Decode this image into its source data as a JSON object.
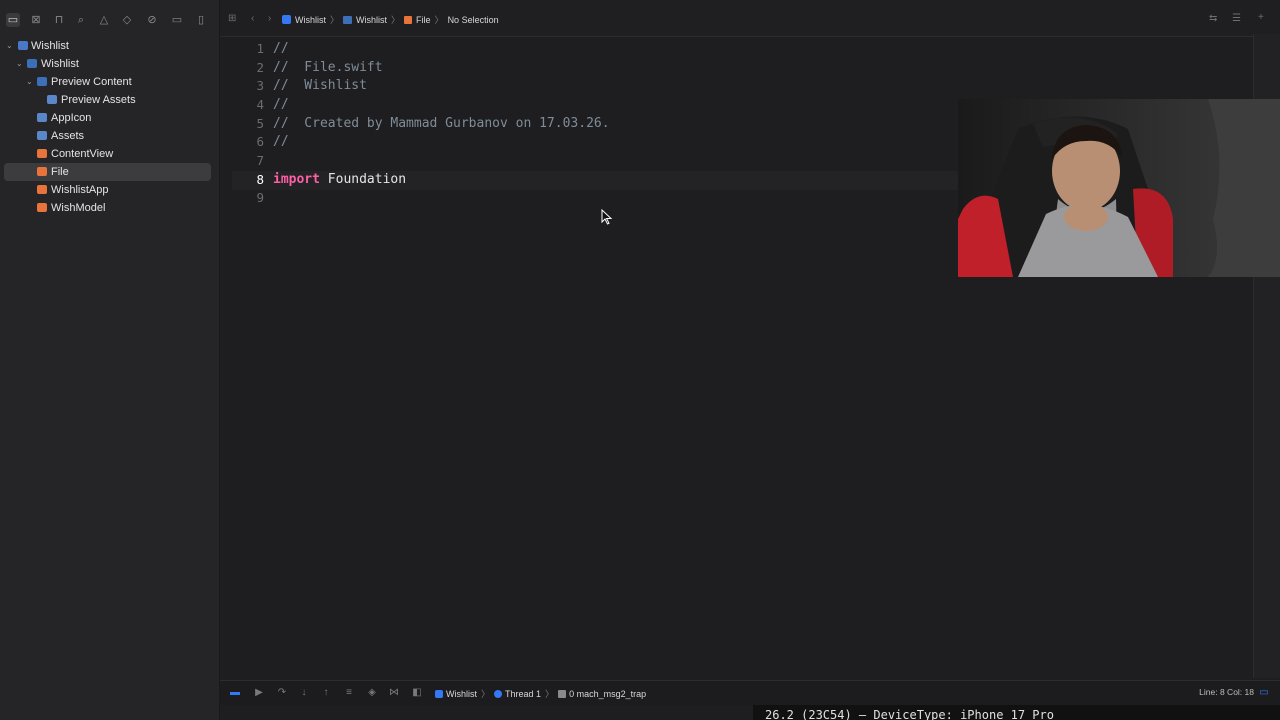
{
  "sidebar": {
    "toolbar_icons": [
      "folder-icon",
      "xmark-square-icon",
      "bookmark-icon",
      "search-icon",
      "warning-icon",
      "diamond-icon",
      "tag-icon",
      "label-icon",
      "document-icon"
    ],
    "tree": [
      {
        "label": "Wishlist",
        "kind": "project"
      },
      {
        "label": "Wishlist",
        "kind": "folder"
      },
      {
        "label": "Preview Content",
        "kind": "folder"
      },
      {
        "label": "Preview Assets",
        "kind": "assets"
      },
      {
        "label": "AppIcon",
        "kind": "file"
      },
      {
        "label": "Assets",
        "kind": "file"
      },
      {
        "label": "ContentView",
        "kind": "file"
      },
      {
        "label": "File",
        "kind": "file",
        "selected": true
      },
      {
        "label": "WishlistApp",
        "kind": "file"
      },
      {
        "label": "WishModel",
        "kind": "file"
      }
    ]
  },
  "breadcrumb": {
    "items": [
      "Wishlist",
      "Wishlist",
      "File",
      "No Selection"
    ]
  },
  "editor": {
    "line_numbers": [
      "1",
      "2",
      "3",
      "4",
      "5",
      "6",
      "7",
      "8",
      "9"
    ],
    "current_line": "8",
    "lines": [
      "//",
      "//  File.swift",
      "//  Wishlist",
      "//",
      "//  Created by Mammad Gurbanov on 17.03.26.",
      "//",
      "",
      "",
      ""
    ],
    "import_keyword": "import",
    "import_module": "Foundation"
  },
  "debug_bar": {
    "crumbs": [
      "Wishlist",
      "Thread 1",
      "0 mach_msg2_trap"
    ],
    "status": "Line: 8  Col: 18"
  },
  "console": {
    "text": "26.2 (23C54) – DeviceType: iPhone 17 Pro"
  },
  "colors": {
    "keyword": "#fc5fa3",
    "comment": "#7f8c98",
    "accent": "#3478f6"
  }
}
